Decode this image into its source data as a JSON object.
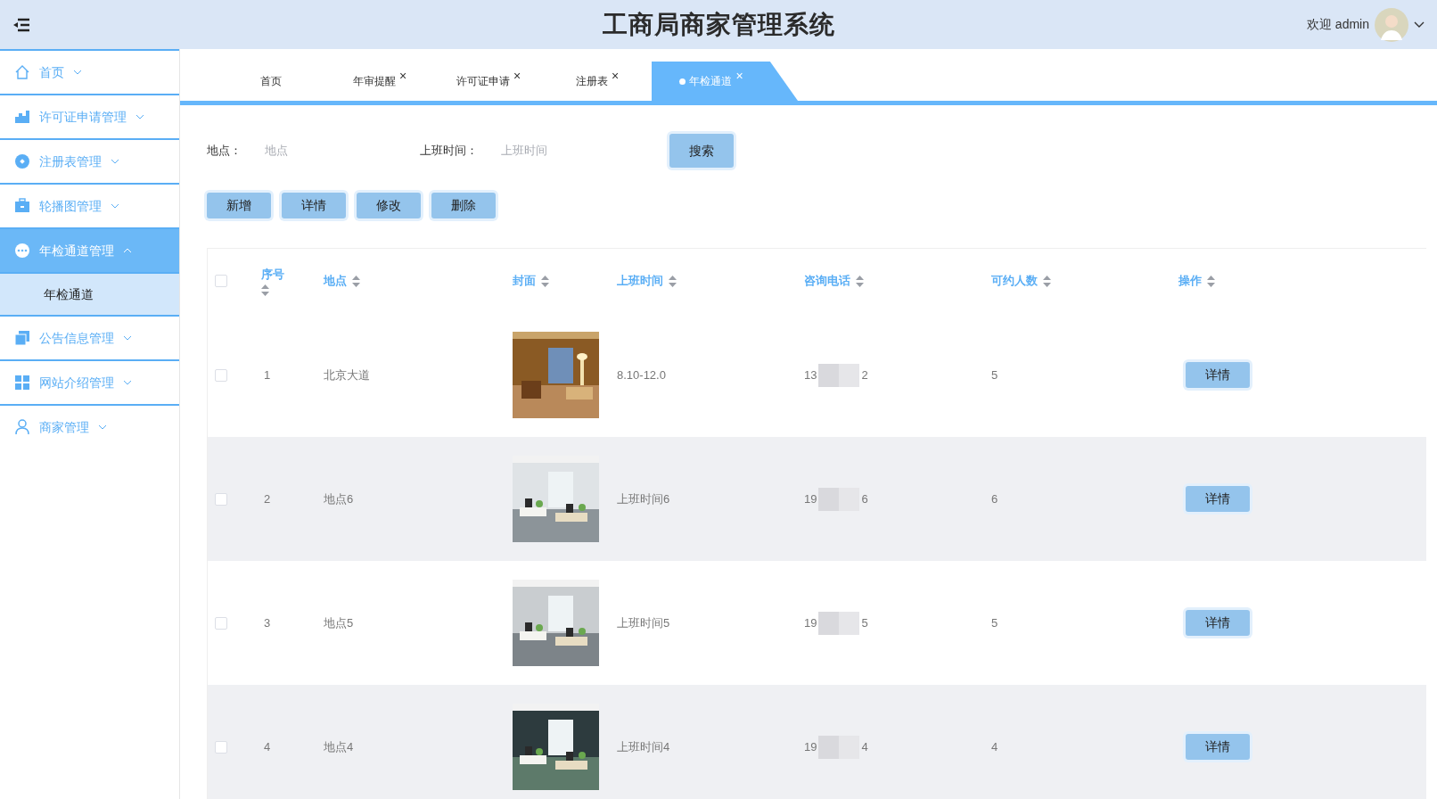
{
  "header": {
    "title": "工商局商家管理系统",
    "welcome": "欢迎 admin"
  },
  "sidebar": {
    "items": [
      {
        "label": "首页",
        "expanded": false,
        "selected": false
      },
      {
        "label": "许可证申请管理",
        "expanded": false,
        "selected": false
      },
      {
        "label": "注册表管理",
        "expanded": false,
        "selected": false
      },
      {
        "label": "轮播图管理",
        "expanded": false,
        "selected": false
      },
      {
        "label": "年检通道管理",
        "expanded": true,
        "selected": true,
        "children": [
          {
            "label": "年检通道",
            "selected": true
          }
        ]
      },
      {
        "label": "公告信息管理",
        "expanded": false,
        "selected": false
      },
      {
        "label": "网站介绍管理",
        "expanded": false,
        "selected": false
      },
      {
        "label": "商家管理",
        "expanded": false,
        "selected": false
      }
    ]
  },
  "tabs": [
    {
      "label": "首页",
      "selected": false
    },
    {
      "label": "年审提醒",
      "selected": false,
      "close": "×"
    },
    {
      "label": "许可证申请",
      "selected": false,
      "close": "×"
    },
    {
      "label": "注册表",
      "selected": false,
      "close": "×"
    },
    {
      "label": "年检通道",
      "selected": true,
      "close": "×"
    }
  ],
  "search": {
    "fields": [
      {
        "label": "地点：",
        "placeholder": "地点"
      },
      {
        "label": "上班时间：",
        "placeholder": "上班时间"
      }
    ],
    "button": "搜索"
  },
  "actions": [
    "新增",
    "详情",
    "修改",
    "删除"
  ],
  "table": {
    "select_all_checked": false,
    "columns": [
      "序号",
      "地点",
      "封面",
      "上班时间",
      "咨询电话",
      "可约人数",
      "操作"
    ],
    "rows": [
      {
        "checked": false,
        "index": "1",
        "place": "北京大道",
        "time": "8.10-12.0",
        "phone_start": "13",
        "phone_end": "2",
        "capacity": "5",
        "action": "详情"
      },
      {
        "checked": false,
        "index": "2",
        "place": "地点6",
        "time": "上班时间6",
        "phone_start": "19",
        "phone_end": "6",
        "capacity": "6",
        "action": "详情"
      },
      {
        "checked": false,
        "index": "3",
        "place": "地点5",
        "time": "上班时间5",
        "phone_start": "19",
        "phone_end": "5",
        "capacity": "5",
        "action": "详情"
      },
      {
        "checked": false,
        "index": "4",
        "place": "地点4",
        "time": "上班时间4",
        "phone_start": "19",
        "phone_end": "4",
        "capacity": "4",
        "action": "详情"
      }
    ]
  }
}
